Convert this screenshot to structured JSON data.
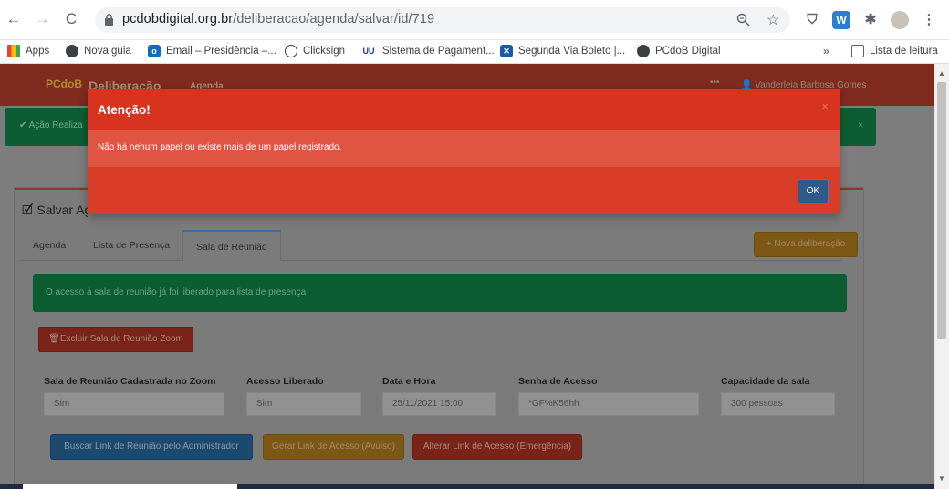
{
  "browser": {
    "url_host": "pcdobdigital.org.br",
    "url_path": "/deliberacao/agenda/salvar/id/719",
    "bookmarks": [
      {
        "label": "Apps"
      },
      {
        "label": "Nova guia"
      },
      {
        "label": "Email – Presidência –..."
      },
      {
        "label": "Clicksign"
      },
      {
        "label": "Sistema de Pagament..."
      },
      {
        "label": "Segunda Via Boleto |..."
      },
      {
        "label": "PCdoB Digital"
      }
    ],
    "more_label": "»",
    "reading_list": "Lista de leitura"
  },
  "app": {
    "logo": "PCdoB",
    "brand": "Deliberação",
    "nav_link": "Agenda",
    "user": "Vanderleia Barbosa Gomes",
    "success_alert": "Ação Realiza",
    "success_close": "×"
  },
  "panel": {
    "title": "Salvar Agenda",
    "tabs": [
      "Agenda",
      "Lista de Presença",
      "Sala de Reunião"
    ],
    "new_button": "Nova deliberação",
    "info_alert": "O acesso à sala de reunião já foi liberado para lista de presença",
    "delete_button": "Excluir Sala de Reunião Zoom",
    "fields": [
      {
        "label": "Sala de Reunião Cadastrada no Zoom",
        "value": "Sim"
      },
      {
        "label": "Acesso Liberado",
        "value": "Sim"
      },
      {
        "label": "Data e Hora",
        "value": "25/11/2021 15:00"
      },
      {
        "label": "Senha de Acesso",
        "value": "*GF%K56hh"
      },
      {
        "label": "Capacidade da sala",
        "value": "300 pessoas"
      }
    ],
    "buttons": [
      {
        "label": "Buscar Link de Reunião pelo Administrador"
      },
      {
        "label": "Gerar Link de Acesso (Avulso)"
      },
      {
        "label": "Alterar Link de Acesso (Emergência)"
      }
    ]
  },
  "modal": {
    "title": "Atenção!",
    "close": "×",
    "message": "Não há nehum papel ou existe mais de um papel registrado.",
    "ok": "OK"
  },
  "colors": {
    "modal_header": "#d7331f",
    "modal_body": "#e05542",
    "ok_button": "#2f5a8a"
  }
}
